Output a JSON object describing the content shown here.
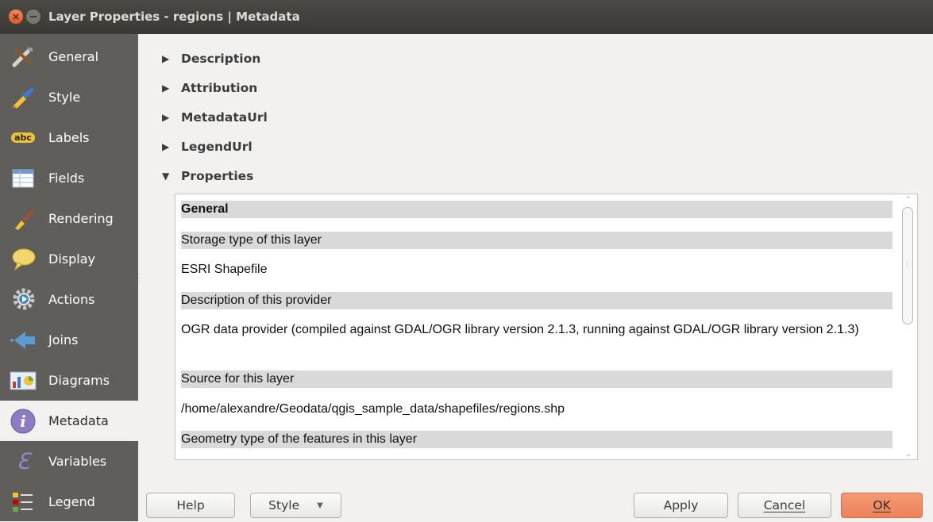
{
  "window": {
    "title": "Layer Properties - regions | Metadata"
  },
  "sidebar": {
    "items": [
      {
        "label": "General",
        "icon": "tools-icon"
      },
      {
        "label": "Style",
        "icon": "paintbrush-icon"
      },
      {
        "label": "Labels",
        "icon": "abc-label-icon",
        "icon_text": "abc"
      },
      {
        "label": "Fields",
        "icon": "table-icon"
      },
      {
        "label": "Rendering",
        "icon": "brush-icon"
      },
      {
        "label": "Display",
        "icon": "speech-bubble-icon"
      },
      {
        "label": "Actions",
        "icon": "gear-icon"
      },
      {
        "label": "Joins",
        "icon": "arrow-left-icon"
      },
      {
        "label": "Diagrams",
        "icon": "diagram-icon"
      },
      {
        "label": "Metadata",
        "icon": "info-icon",
        "active": true
      },
      {
        "label": "Variables",
        "icon": "epsilon-icon"
      },
      {
        "label": "Legend",
        "icon": "legend-icon"
      }
    ]
  },
  "sections": {
    "description": "Description",
    "attribution": "Attribution",
    "metadata_url": "MetadataUrl",
    "legend_url": "LegendUrl",
    "properties": "Properties"
  },
  "properties": {
    "general": "General",
    "storage_type_label": "Storage type of this layer",
    "storage_type_value": "ESRI Shapefile",
    "provider_label": "Description of this provider",
    "provider_value": "OGR data provider (compiled against GDAL/OGR library version 2.1.3, running against GDAL/OGR library version 2.1.3)",
    "source_label": "Source for this layer",
    "source_value": "/home/alexandre/Geodata/qgis_sample_data/shapefiles/regions.shp",
    "geometry_label": "Geometry type of the features in this layer"
  },
  "buttons": {
    "help": "Help",
    "style": "Style",
    "apply": "Apply",
    "cancel": "Cancel",
    "ok": "OK"
  },
  "colors": {
    "sidebar_bg": "#5f5e5a",
    "titlebar_bg": "#3c3b37",
    "ok_accent": "#ef8a63",
    "close_button": "#e95420"
  }
}
